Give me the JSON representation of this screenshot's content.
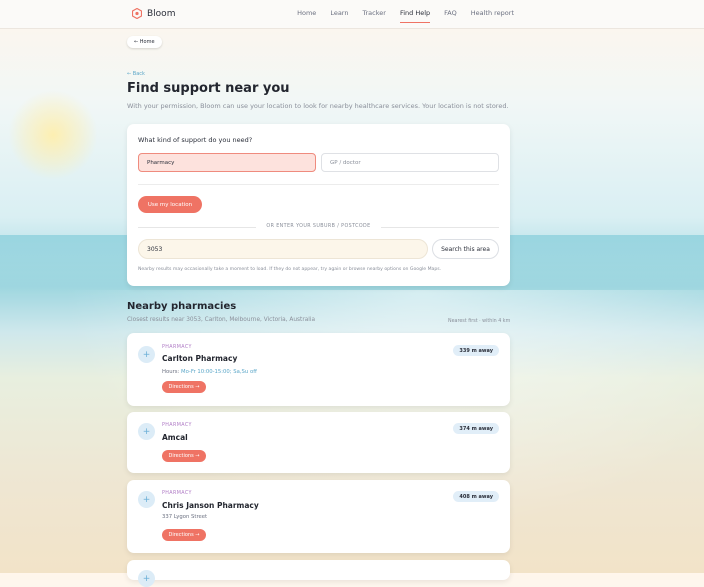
{
  "brand": {
    "name": "Bloom"
  },
  "nav": {
    "items": [
      "Home",
      "Learn",
      "Tracker",
      "Find Help",
      "FAQ",
      "Health report"
    ],
    "active": "Find Help"
  },
  "home_pill": "← Home",
  "back_link": "← Back",
  "page": {
    "title": "Find support near you",
    "subtitle": "With your permission, Bloom can use your location to look for nearby healthcare services. Your location is not stored."
  },
  "support": {
    "question": "What kind of support do you need?",
    "options": [
      "Pharmacy",
      "GP / doctor"
    ],
    "selected": "Pharmacy",
    "use_location": "Use my location",
    "or_text": "OR ENTER YOUR SUBURB / POSTCODE",
    "postcode_value": "3053",
    "search_button": "Search this area",
    "note": "Nearby results may occasionally take a moment to load. If they do not appear, try again or browse nearby options on Google Maps."
  },
  "results": {
    "title": "Nearby pharmacies",
    "subtitle": "Closest results near 3053, Carlton, Melbourne, Victoria, Australia",
    "meta": "Nearest first · within 4 km",
    "items": [
      {
        "category": "PHARMACY",
        "name": "Carlton Pharmacy",
        "hours_label": "Hours:",
        "hours": "Mo-Fr 10:00-15:00; Sa,Su off",
        "distance": "339 m away",
        "directions": "Directions →"
      },
      {
        "category": "PHARMACY",
        "name": "Amcal",
        "distance": "374 m away",
        "directions": "Directions →"
      },
      {
        "category": "PHARMACY",
        "name": "Chris Janson Pharmacy",
        "address": "337 Lygon Street",
        "distance": "408 m away",
        "directions": "Directions →"
      }
    ]
  },
  "colors": {
    "accent": "#ef7364",
    "link": "#5aa6c8",
    "category": "#b07cc6"
  }
}
